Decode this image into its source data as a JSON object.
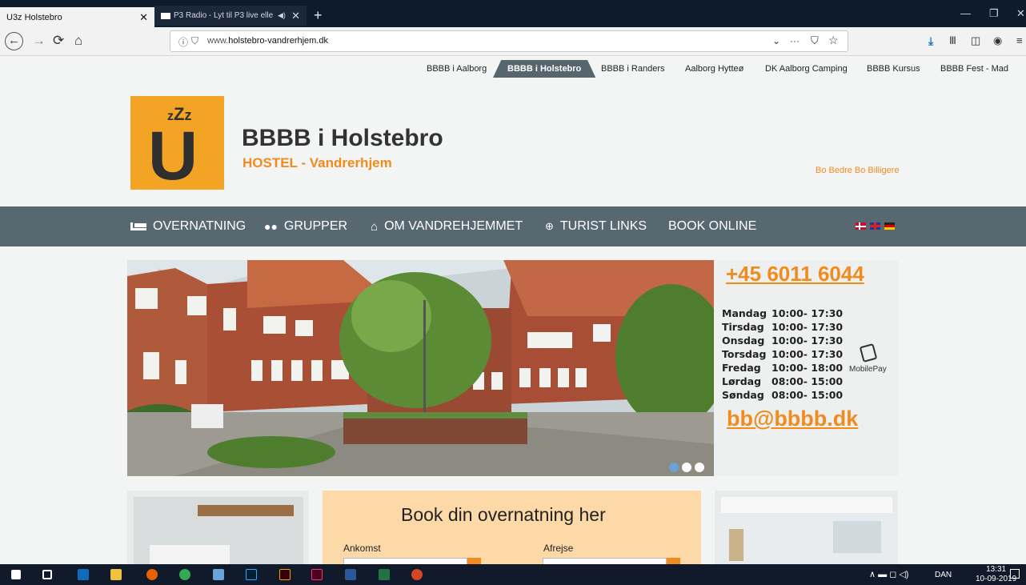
{
  "browser": {
    "tabs": [
      {
        "title": "U3z Holstebro",
        "close": "✕"
      },
      {
        "title": "P3 Radio - Lyt til P3 live elle",
        "close": "✕",
        "audio": "◀)"
      }
    ],
    "new_tab": "+",
    "window_controls": [
      "—",
      "❐",
      "✕"
    ],
    "url": {
      "prefix": "www.",
      "domain": "holstebro-vandrerhjem.dk"
    },
    "url_actions": [
      "⌄",
      "···",
      "⛉",
      "☆"
    ],
    "nav_icons": [
      "back-icon",
      "forward-icon",
      "reload-icon",
      "home-icon"
    ],
    "toolbar_icons": [
      "download-icon",
      "library-icon",
      "sidebar-icon",
      "account-icon",
      "menu-icon"
    ]
  },
  "site_tabs": [
    {
      "label": "BBBB i Aalborg"
    },
    {
      "label": "BBBB i Holstebro",
      "active": true
    },
    {
      "label": "BBBB i Randers"
    },
    {
      "label": "Aalborg Hytteø"
    },
    {
      "label": "DK Aalborg Camping"
    },
    {
      "label": "BBBB Kursus"
    },
    {
      "label": "BBBB Fest - Mad"
    }
  ],
  "header": {
    "logo_letter": "U",
    "logo_z": "zZz",
    "title": "BBBB i Holstebro",
    "subtitle": "HOSTEL - Vandrerhjem",
    "tagline": "Bo Bedre Bo Billigere"
  },
  "main_nav": [
    {
      "label": "OVERNATNING",
      "icon": "bed-icon"
    },
    {
      "label": "GRUPPER",
      "icon": "group-icon"
    },
    {
      "label": "OM VANDREHJEMMET",
      "icon": "house-icon"
    },
    {
      "label": "TURIST LINKS",
      "icon": "globe-icon"
    },
    {
      "label": "BOOK ONLINE",
      "icon": ""
    }
  ],
  "languages": [
    "danish-flag",
    "english-flag",
    "german-flag"
  ],
  "contact": {
    "phone": "+45 6011 6044",
    "hours": [
      {
        "day": "Mandag",
        "time": "10:00- 17:30"
      },
      {
        "day": "Tirsdag",
        "time": "10:00- 17:30"
      },
      {
        "day": "Onsdag",
        "time": "10:00- 17:30"
      },
      {
        "day": "Torsdag",
        "time": "10:00- 17:30"
      },
      {
        "day": "Fredag",
        "time": "10:00- 18:00"
      },
      {
        "day": "Lørdag",
        "time": "08:00- 15:00"
      },
      {
        "day": "Søndag",
        "time": "08:00- 15:00"
      }
    ],
    "mobilepay": "MobilePay",
    "email": "bb@bbbb.dk"
  },
  "booking": {
    "title": "Book din overnatning her",
    "arrival_label": "Ankomst",
    "departure_label": "Afrejse"
  },
  "taskbar": {
    "language": "DAN",
    "time": "13:31",
    "date": "10-09-2019"
  },
  "colors": {
    "accent": "#f08b1e",
    "nav": "#586871",
    "logo": "#f4a425",
    "booking_bg": "#fdd9a8"
  }
}
